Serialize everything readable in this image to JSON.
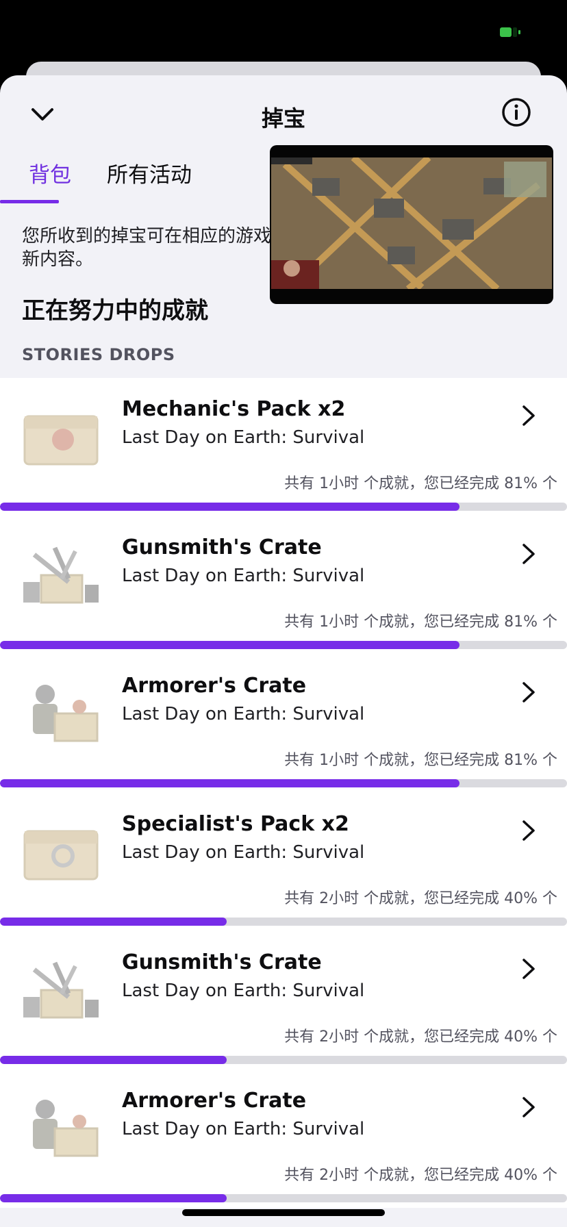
{
  "header": {
    "title": "掉宝",
    "tabs": [
      {
        "label": "背包",
        "active": true
      },
      {
        "label": "所有活动",
        "active": false
      }
    ]
  },
  "intro": {
    "line1": "您所收到的掉宝可在相应的游戏",
    "line2": "新内容。"
  },
  "section_title": "正在努力中的成就",
  "section_subtitle": "STORIES DROPS",
  "colors": {
    "accent": "#772CE8",
    "progress_track": "#DADADF",
    "background": "#F2F2F7"
  },
  "items": [
    {
      "title": "Mechanic's Pack x2",
      "game": "Last Day on Earth: Survival",
      "progress_text": "共有 1小时 个成就，您已经完成 81% 个",
      "progress": 0.81,
      "icon": "supply-crate-icon"
    },
    {
      "title": "Gunsmith's Crate",
      "game": "Last Day on Earth: Survival",
      "progress_text": "共有 1小时 个成就，您已经完成 81% 个",
      "progress": 0.81,
      "icon": "weapons-crate-icon"
    },
    {
      "title": "Armorer's Crate",
      "game": "Last Day on Earth: Survival",
      "progress_text": "共有 1小时 个成就，您已经完成 81% 个",
      "progress": 0.81,
      "icon": "armor-crate-icon"
    },
    {
      "title": "Specialist's Pack x2",
      "game": "Last Day on Earth: Survival",
      "progress_text": "共有 2小时 个成就，您已经完成 40% 个",
      "progress": 0.4,
      "icon": "supply-crate-icon"
    },
    {
      "title": "Gunsmith's Crate",
      "game": "Last Day on Earth: Survival",
      "progress_text": "共有 2小时 个成就，您已经完成 40% 个",
      "progress": 0.4,
      "icon": "weapons-crate-icon"
    },
    {
      "title": "Armorer's Crate",
      "game": "Last Day on Earth: Survival",
      "progress_text": "共有 2小时 个成就，您已经完成 40% 个",
      "progress": 0.4,
      "icon": "armor-crate-icon"
    }
  ]
}
